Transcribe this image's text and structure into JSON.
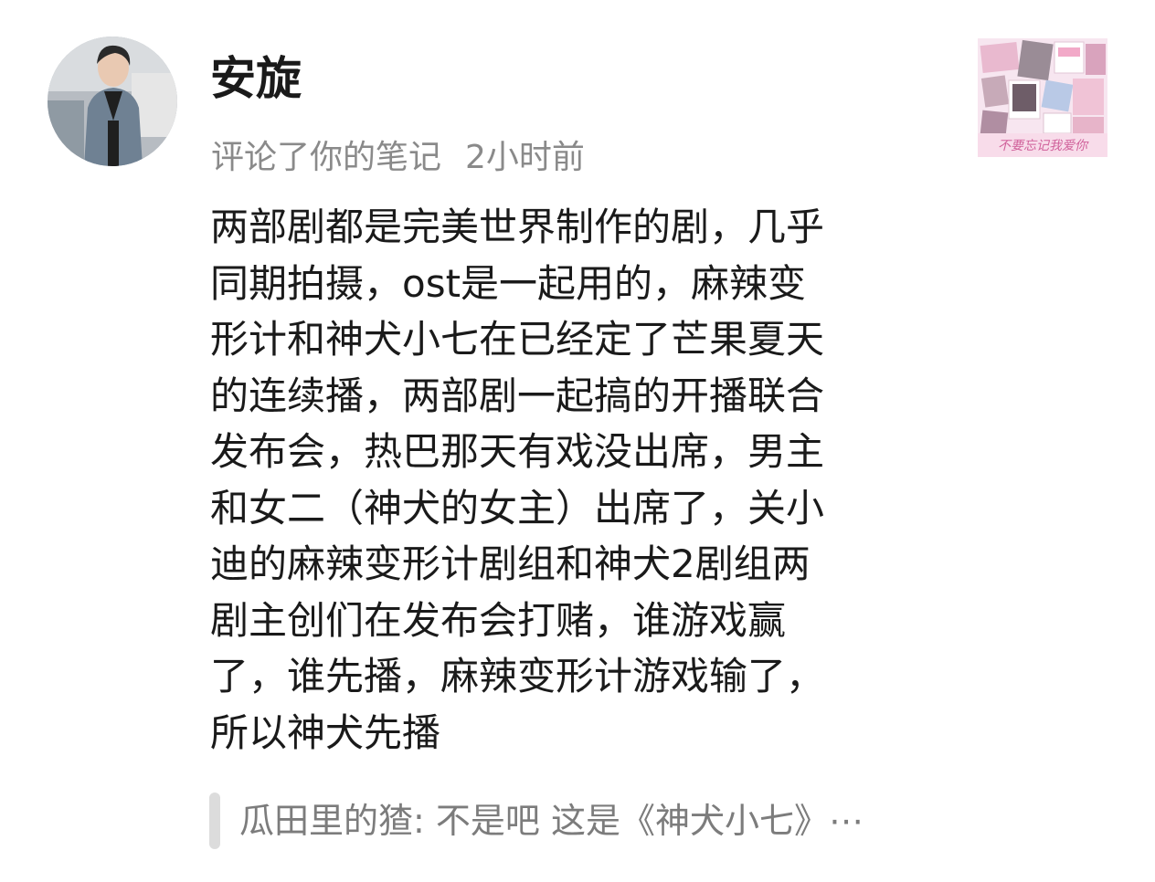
{
  "notification": {
    "username": "安旋",
    "action": "评论了你的笔记",
    "time": "2小时前",
    "comment_lines": [
      "两部剧都是完美世界制作的剧，几乎",
      "同期拍摄，ost是一起用的，麻辣变",
      "形计和神犬小七在已经定了芒果夏天",
      "的连续播，两部剧一起搞的开播联合",
      "发布会，热巴那天有戏没出席，男主",
      "和女二（神犬的女主）出席了，关小",
      "迪的麻辣变形计剧组和神犬2剧组两",
      "剧主创们在发布会打赌，谁游戏赢",
      "了，谁先播，麻辣变形计游戏输了，",
      "所以神犬先播"
    ],
    "quoted_comment": "瓜田里的猹: 不是吧 这是《神犬小七》⋯",
    "thumbnail_caption": "不要忘记我爱你"
  },
  "colors": {
    "username": "#1a1a1a",
    "meta": "#8a8a8a",
    "body_text": "#1a1a1a",
    "quote_text": "#7c7c7c",
    "quote_bar": "#dcdcdc",
    "background": "#ffffff"
  }
}
